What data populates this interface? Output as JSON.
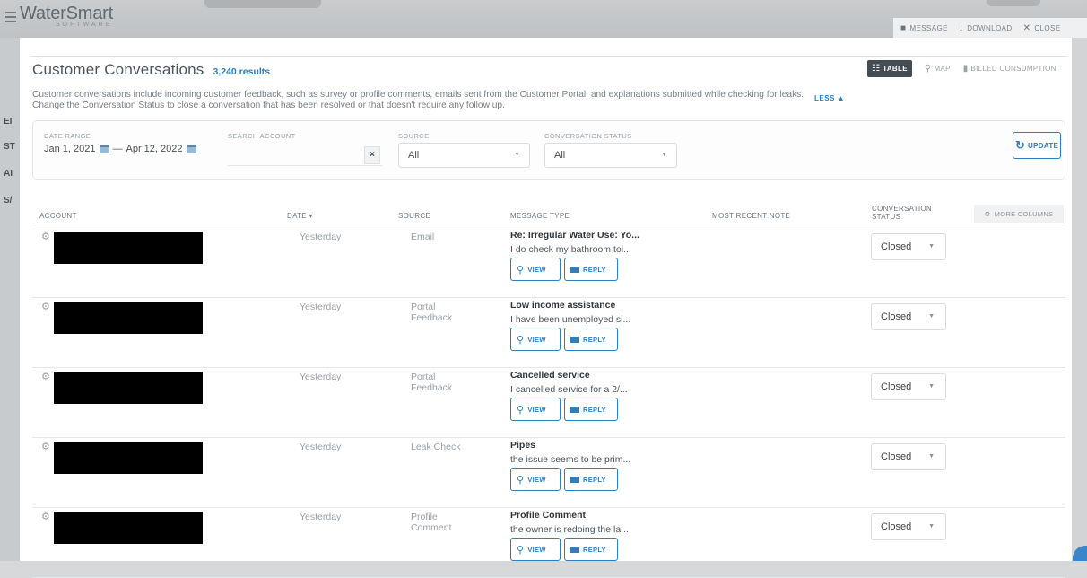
{
  "app": {
    "brand": "WaterSmart",
    "brand_sub": "SOFTWARE",
    "left_rail_letters": [
      "EI",
      "ST",
      "AI",
      "S/"
    ]
  },
  "panel_actions": {
    "message": "MESSAGE",
    "download": "DOWNLOAD",
    "close": "CLOSE"
  },
  "header": {
    "title": "Customer Conversations",
    "result_count": "3,240 results",
    "description": "Customer conversations include incoming customer feedback, such as survey or profile comments, emails sent from the Customer Portal, and explanations submitted while checking for leaks. Change the Conversation Status to close a conversation that has been resolved or that doesn't require any follow up.",
    "less_link": "LESS ▲"
  },
  "view_switch": {
    "table": "TABLE",
    "map": "MAP",
    "billed": "BILLED CONSUMPTION"
  },
  "filters": {
    "date_range_label": "DATE RANGE",
    "date_from": "Jan 1, 2021",
    "date_sep": "—",
    "date_to": "Apr 12, 2022",
    "search_label": "SEARCH ACCOUNT",
    "search_value": "",
    "clear": "×",
    "source_label": "SOURCE",
    "source_value": "All",
    "status_label": "CONVERSATION STATUS",
    "status_value": "All",
    "update": "UPDATE"
  },
  "table": {
    "columns": {
      "account": "ACCOUNT",
      "date": "DATE ▾",
      "source": "SOURCE",
      "message_type": "MESSAGE TYPE",
      "recent_note": "MOST RECENT NOTE",
      "status_line1": "CONVERSATION",
      "status_line2": "STATUS",
      "more_columns": "MORE COLUMNS"
    },
    "view_label": "VIEW",
    "reply_label": "REPLY",
    "rows": [
      {
        "date": "Yesterday",
        "source": "Email",
        "title": "Re: Irregular Water Use: Yo...",
        "preview": "I do check my bathroom toi...",
        "status": "Closed"
      },
      {
        "date": "Yesterday",
        "source": "Portal Feedback",
        "title": "Low income assistance",
        "preview": "I have been unemployed si...",
        "status": "Closed"
      },
      {
        "date": "Yesterday",
        "source": "Portal Feedback",
        "title": "Cancelled service",
        "preview": "I cancelled service for a 2/...",
        "status": "Closed"
      },
      {
        "date": "Yesterday",
        "source": "Leak Check",
        "title": "Pipes",
        "preview": "the issue seems to be prim...",
        "status": "Closed"
      },
      {
        "date": "Yesterday",
        "source": "Profile Comment",
        "title": "Profile Comment",
        "preview": "the owner is redoing the la...",
        "status": "Closed"
      }
    ]
  },
  "colors": {
    "accent": "#2d7fbd",
    "redaction": "#000000",
    "dark_toggle": "#454d54"
  }
}
